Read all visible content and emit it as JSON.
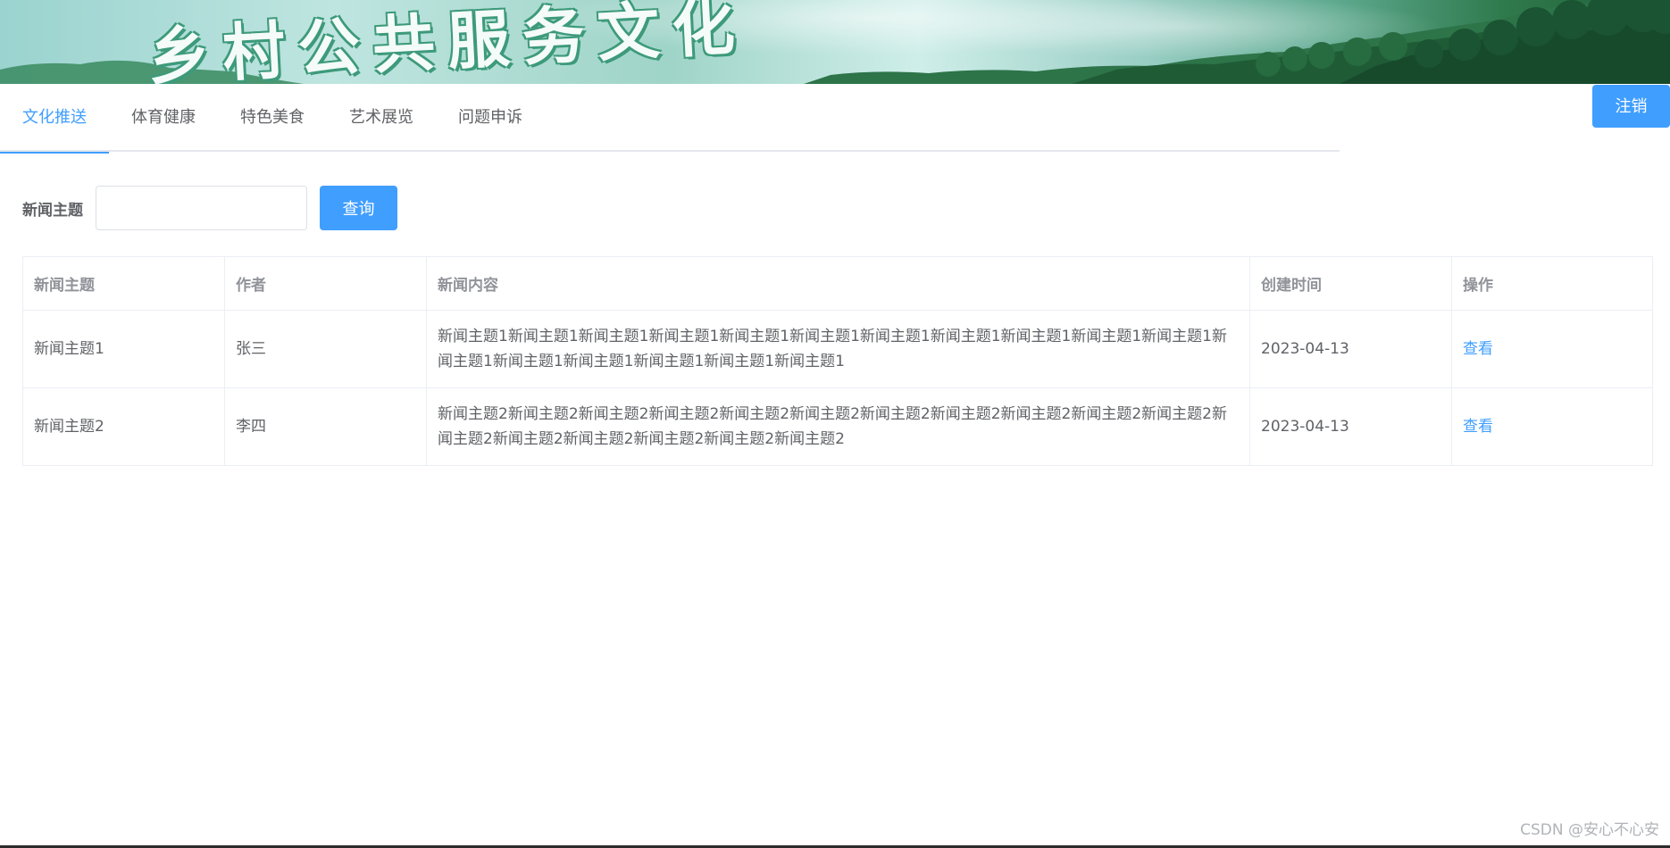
{
  "banner": {
    "title": "乡村公共服务文化"
  },
  "header": {
    "logout_label": "注销"
  },
  "tabs": [
    {
      "label": "文化推送",
      "active": true
    },
    {
      "label": "体育健康",
      "active": false
    },
    {
      "label": "特色美食",
      "active": false
    },
    {
      "label": "艺术展览",
      "active": false
    },
    {
      "label": "问题申诉",
      "active": false
    }
  ],
  "search": {
    "label": "新闻主题",
    "value": "",
    "placeholder": "",
    "button_label": "查询"
  },
  "table": {
    "columns": [
      "新闻主题",
      "作者",
      "新闻内容",
      "创建时间",
      "操作"
    ],
    "rows": [
      {
        "topic": "新闻主题1",
        "author": "张三",
        "content": "新闻主题1新闻主题1新闻主题1新闻主题1新闻主题1新闻主题1新闻主题1新闻主题1新闻主题1新闻主题1新闻主题1新闻主题1新闻主题1新闻主题1新闻主题1新闻主题1新闻主题1",
        "created": "2023-04-13",
        "action": "查看"
      },
      {
        "topic": "新闻主题2",
        "author": "李四",
        "content": "新闻主题2新闻主题2新闻主题2新闻主题2新闻主题2新闻主题2新闻主题2新闻主题2新闻主题2新闻主题2新闻主题2新闻主题2新闻主题2新闻主题2新闻主题2新闻主题2新闻主题2",
        "created": "2023-04-13",
        "action": "查看"
      }
    ]
  },
  "watermark": "CSDN @安心不心安",
  "colors": {
    "accent": "#409eff",
    "text": "#606266",
    "header_text": "#909399",
    "border": "#ebeef5"
  }
}
